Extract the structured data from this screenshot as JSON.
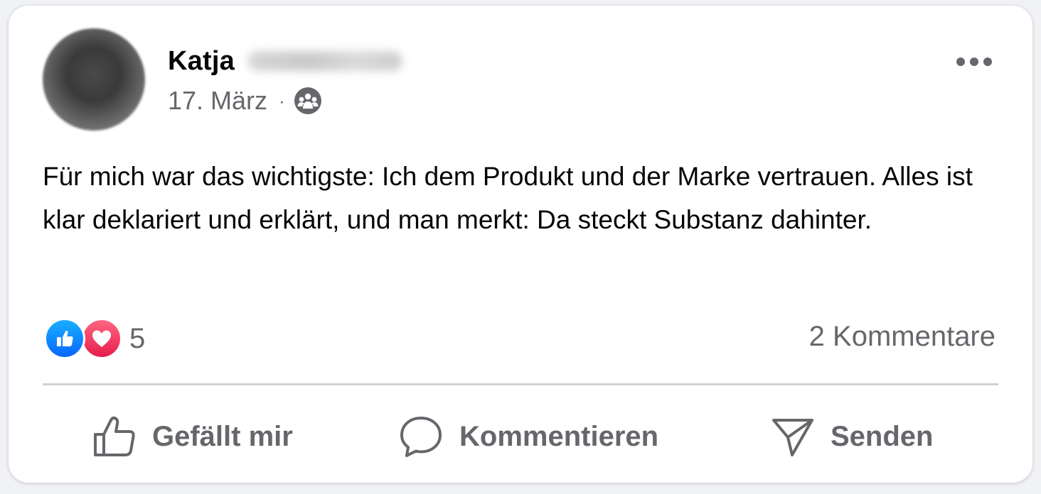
{
  "post": {
    "author_first_name": "Katja",
    "author_last_name_blurred": true,
    "date": "17. März",
    "separator": "·",
    "audience_icon": "group-icon",
    "more_icon": "more-horizontal-icon",
    "text": "Für mich war das wichtigste: Ich dem Produkt und der Marke vertrauen. Alles ist klar deklariert und erklärt, und man merkt: Da steckt Substanz dahinter."
  },
  "reactions": {
    "types": [
      "like-icon",
      "love-icon"
    ],
    "count": "5",
    "comments_label": "2 Kommentare"
  },
  "actions": {
    "like_label": "Gefällt mir",
    "comment_label": "Kommentieren",
    "send_label": "Senden"
  },
  "colors": {
    "like_blue": "#0866ff",
    "love_red": "#e61e4d",
    "secondary_text": "#65676b",
    "primary_text": "#050505"
  }
}
